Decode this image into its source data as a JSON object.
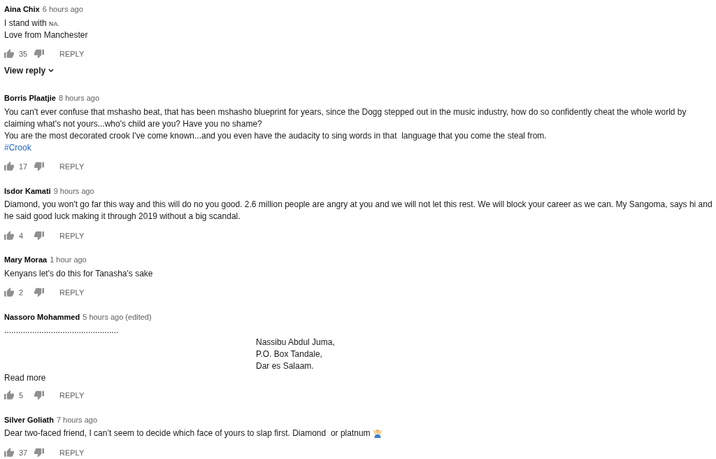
{
  "comments": [
    {
      "author": "Aina Chix",
      "time": "6 hours ago",
      "lines": [
        {
          "kind": "text",
          "parts": [
            {
              "kind": "plain",
              "text": "I stand with "
            },
            {
              "kind": "smallcaps",
              "text": "NA."
            }
          ]
        },
        {
          "kind": "text",
          "parts": [
            {
              "kind": "plain",
              "text": "Love from Manchester"
            }
          ]
        }
      ],
      "likes": "35",
      "reply_label": "REPLY",
      "view_replies": "View reply"
    },
    {
      "author": "Borris Plaatjie",
      "time": "8 hours ago",
      "lines": [
        {
          "kind": "text",
          "parts": [
            {
              "kind": "plain",
              "text": "You can't ever confuse that mshasho beat, that has been mshasho blueprint for years, since the Dogg stepped out in the music industry, how do so confidently cheat the whole world by"
            }
          ]
        },
        {
          "kind": "text",
          "parts": [
            {
              "kind": "plain",
              "text": "claiming what's not yours...who's child are you? Have you no shame?"
            }
          ]
        },
        {
          "kind": "text",
          "parts": [
            {
              "kind": "plain",
              "text": "You are the most decorated crook I've come known...and you even have the audacity to sing words in that  language that you come the steal from."
            }
          ]
        },
        {
          "kind": "hashtag",
          "text": "#Crook"
        }
      ],
      "likes": "17",
      "reply_label": "REPLY"
    },
    {
      "author": "Isdor Kamati",
      "time": "9 hours ago",
      "lines": [
        {
          "kind": "text",
          "parts": [
            {
              "kind": "plain",
              "text": "Diamond, you won't go far this way and this will do no you good. 2.6 million people are angry at you and we will not let this rest. We will block your career as we can. My Sangoma, says hi and"
            }
          ]
        },
        {
          "kind": "text",
          "parts": [
            {
              "kind": "plain",
              "text": "he said good luck making it through 2019 without a big scandal."
            }
          ]
        }
      ],
      "likes": "4",
      "reply_label": "REPLY"
    },
    {
      "author": "Mary Moraa",
      "time": "1 hour ago",
      "lines": [
        {
          "kind": "text",
          "parts": [
            {
              "kind": "plain",
              "text": "Kenyans let's do this for Tanasha's sake"
            }
          ]
        }
      ],
      "likes": "2",
      "reply_label": "REPLY"
    },
    {
      "author": "Nassoro Mohammed",
      "time": "5 hours ago (edited)",
      "lines": [
        {
          "kind": "text",
          "parts": [
            {
              "kind": "plain",
              "text": "................................................."
            }
          ]
        },
        {
          "kind": "indented",
          "parts": [
            {
              "kind": "plain",
              "text": "Nassibu Abdul Juma,"
            }
          ]
        },
        {
          "kind": "indented",
          "parts": [
            {
              "kind": "plain",
              "text": "P.O. Box Tandale,"
            }
          ]
        },
        {
          "kind": "indented",
          "parts": [
            {
              "kind": "plain",
              "text": "Dar es Salaam."
            }
          ]
        }
      ],
      "read_more": "Read more",
      "likes": "5",
      "reply_label": "REPLY"
    },
    {
      "author": "Silver Goliath",
      "time": "7 hours ago",
      "lines": [
        {
          "kind": "text",
          "parts": [
            {
              "kind": "plain",
              "text": "Dear two-faced friend, I can’t seem to decide which face of yours to slap first. Diamond  or platnum "
            },
            {
              "kind": "emoji"
            }
          ]
        }
      ],
      "likes": "37",
      "reply_label": "REPLY"
    }
  ]
}
